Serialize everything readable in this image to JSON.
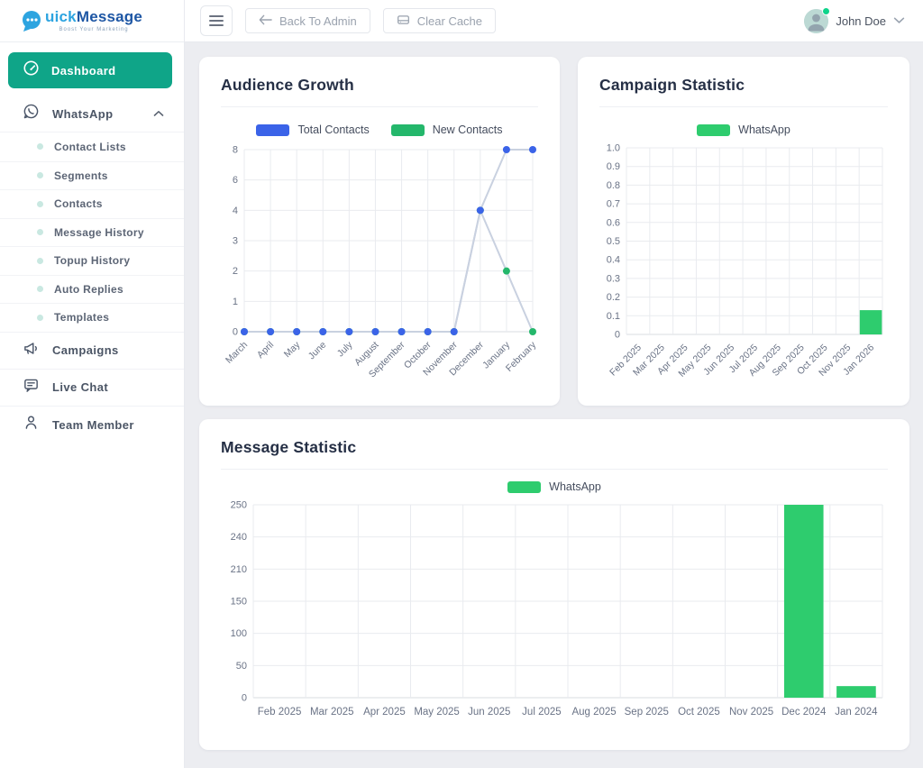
{
  "brand": {
    "prefix": "uick",
    "suffix": "Message",
    "tagline": "Boost Your Marketing"
  },
  "topbar": {
    "back_button": "Back To Admin",
    "clear_cache_button": "Clear Cache",
    "user_name": "John Doe"
  },
  "sidebar": {
    "items": [
      {
        "label": "Dashboard",
        "icon": "speedometer-icon",
        "active": true
      },
      {
        "label": "WhatsApp",
        "icon": "whatsapp-icon",
        "expanded": true,
        "children": [
          "Contact Lists",
          "Segments",
          "Contacts",
          "Message History",
          "Topup History",
          "Auto Replies",
          "Templates"
        ]
      },
      {
        "label": "Campaigns",
        "icon": "megaphone-icon"
      },
      {
        "label": "Live Chat",
        "icon": "chat-icon"
      },
      {
        "label": "Team Member",
        "icon": "person-icon"
      }
    ]
  },
  "colors": {
    "accent_green": "#0fa588",
    "chart_green": "#2ecc6e",
    "chart_blue": "#3b63e8",
    "line_gray": "#c9d1e0",
    "grid": "#e9ebef",
    "axis_line": "#d8dce2",
    "status_dot": "#0ed38a"
  },
  "chart_data": [
    {
      "id": "audience_growth",
      "type": "line",
      "title": "Audience Growth",
      "categories": [
        "March",
        "April",
        "May",
        "June",
        "July",
        "August",
        "September",
        "October",
        "November",
        "December",
        "January",
        "February"
      ],
      "series": [
        {
          "name": "Total Contacts",
          "color": "#3b63e8",
          "values": [
            0,
            0,
            0,
            0,
            0,
            0,
            0,
            0,
            0,
            4,
            8,
            8
          ]
        },
        {
          "name": "New Contacts",
          "color": "#24b76b",
          "values": [
            0,
            0,
            0,
            0,
            0,
            0,
            0,
            0,
            0,
            4,
            2,
            0
          ]
        }
      ],
      "y_ticks": [
        "8",
        "6",
        "4",
        "3",
        "2",
        "1",
        "0"
      ],
      "ylim": [
        0,
        8
      ],
      "grid": true,
      "legend_position": "top",
      "x_label_rotation": -45
    },
    {
      "id": "campaign_statistic",
      "type": "bar",
      "title": "Campaign Statistic",
      "categories": [
        "Feb 2025",
        "Mar 2025",
        "Apr 2025",
        "May 2025",
        "Jun 2025",
        "Jul 2025",
        "Aug 2025",
        "Sep 2025",
        "Oct 2025",
        "Nov 2025",
        "Jan 2026"
      ],
      "series": [
        {
          "name": "WhatsApp",
          "color": "#2ecc6e",
          "values": [
            0,
            0,
            0,
            0,
            0,
            0,
            0,
            0,
            0,
            0,
            0.13
          ]
        }
      ],
      "y_ticks": [
        "1.0",
        "0.9",
        "0.8",
        "0.7",
        "0.6",
        "0.5",
        "0.4",
        "0.3",
        "0.2",
        "0.1",
        "0"
      ],
      "ylim": [
        0,
        1.0
      ],
      "grid": true,
      "legend_position": "top",
      "x_label_rotation": -45
    },
    {
      "id": "message_statistic",
      "type": "bar",
      "title": "Message Statistic",
      "categories": [
        "Feb 2025",
        "Mar 2025",
        "Apr 2025",
        "May 2025",
        "Jun 2025",
        "Jul 2025",
        "Aug 2025",
        "Sep 2025",
        "Oct 2025",
        "Nov 2025",
        "Dec 2024",
        "Jan 2024"
      ],
      "series": [
        {
          "name": "WhatsApp",
          "color": "#2ecc6e",
          "values": [
            0,
            0,
            0,
            0,
            0,
            0,
            0,
            0,
            0,
            0,
            250,
            18
          ]
        }
      ],
      "y_ticks": [
        "250",
        "240",
        "210",
        "150",
        "100",
        "50",
        "0"
      ],
      "ylim": [
        0,
        250
      ],
      "grid": true,
      "legend_position": "top",
      "x_label_rotation": 0
    }
  ]
}
